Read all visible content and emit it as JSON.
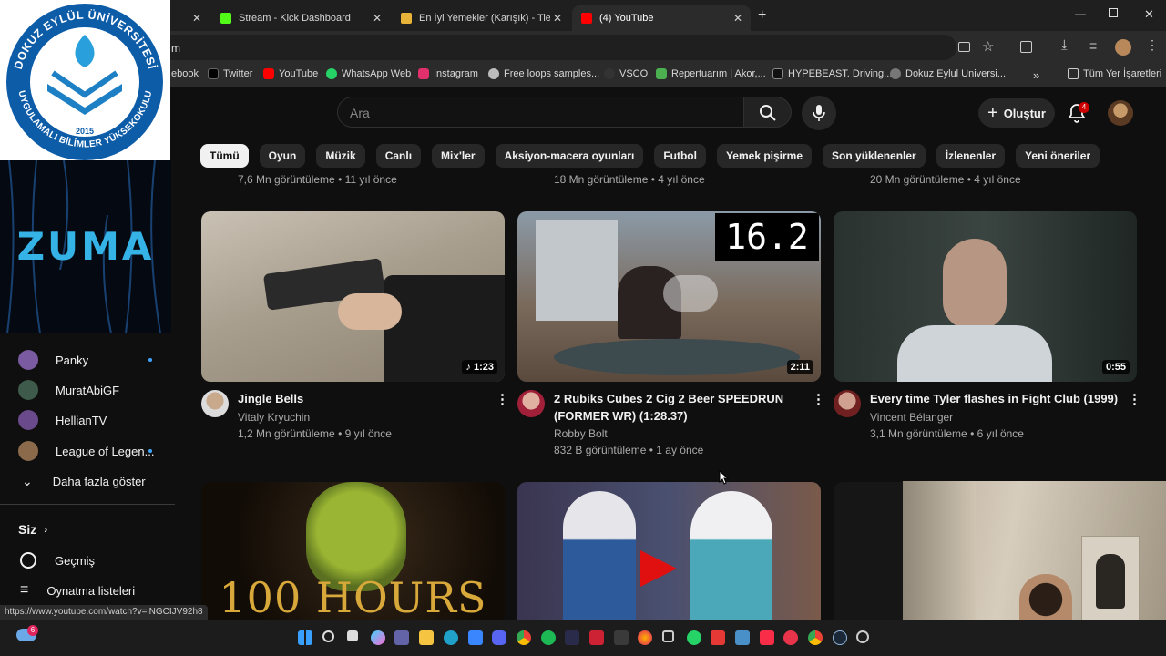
{
  "browser": {
    "tabs": [
      {
        "label": "Mic",
        "color": "#5fd26a",
        "active": false
      },
      {
        "label": "Stream - Kick Dashboard",
        "color": "#53fc18",
        "active": false
      },
      {
        "label": "En İyi Yemekler (Karışık) - Tier L",
        "color": "#e8b339",
        "active": false
      },
      {
        "label": "(4) YouTube",
        "color": "#ff0000",
        "active": true
      }
    ],
    "address_tail": "m",
    "bookmarks": [
      {
        "label": "ebook",
        "color": "#1877f2"
      },
      {
        "label": "Twitter",
        "color": "#000000"
      },
      {
        "label": "YouTube",
        "color": "#ff0000"
      },
      {
        "label": "WhatsApp Web",
        "color": "#25d366"
      },
      {
        "label": "Instagram",
        "color": "#e1306c"
      },
      {
        "label": "Free loops samples...",
        "color": "#bbbbbb"
      },
      {
        "label": "VSCO",
        "color": "#333333"
      },
      {
        "label": "Repertuarım | Akor,...",
        "color": "#4caf50"
      },
      {
        "label": "HYPEBEAST. Driving...",
        "color": "#111111"
      },
      {
        "label": "Dokuz Eylul Universi...",
        "color": "#777777"
      }
    ],
    "bookmarks_overflow": "»",
    "all_bookmarks": "Tüm Yer İşaretleri",
    "status_url": "https://www.youtube.com/watch?v=iNGCIJV92h8"
  },
  "header": {
    "search_placeholder": "Ara",
    "create_label": "Oluştur",
    "notif_count": "4"
  },
  "chips": [
    "Tümü",
    "Oyun",
    "Müzik",
    "Canlı",
    "Mix'ler",
    "Aksiyon-macera oyunları",
    "Futbol",
    "Yemek pişirme",
    "Son yüklenenler",
    "İzlenenler",
    "Yeni öneriler"
  ],
  "partial_meta": [
    "7,6 Mn görüntüleme • 11 yıl önce",
    "18 Mn görüntüleme • 4 yıl önce",
    "20 Mn görüntüleme • 4 yıl önce"
  ],
  "videos": [
    {
      "title": "Jingle Bells",
      "channel": "Vitaly Kryuchin",
      "meta": "1,2 Mn görüntüleme • 9 yıl önce",
      "duration": "♪ 1:23"
    },
    {
      "title": "2 Rubiks Cubes 2 Cig 2 Beer SPEEDRUN (FORMER WR) (1:28.37)",
      "channel": "Robby Bolt",
      "meta": "832 B görüntüleme • 1 ay önce",
      "duration": "2:11",
      "overlay": "16.2"
    },
    {
      "title": "Every time Tyler flashes in Fight Club (1999)",
      "channel": "Vincent Bélanger",
      "meta": "3,1 Mn görüntüleme • 6 yıl önce",
      "duration": "0:55"
    }
  ],
  "row2_thumb_text": "100 HOURS",
  "sidebar": {
    "subs": [
      {
        "name": "Panky",
        "dot": true,
        "color": "#7a5aa0"
      },
      {
        "name": "MuratAbiGF",
        "dot": false,
        "color": "#3d5a4a"
      },
      {
        "name": "HellianTV",
        "dot": false,
        "color": "#6a4a8a"
      },
      {
        "name": "League of Legen...",
        "dot": true,
        "color": "#8a6a4a"
      }
    ],
    "more": "Daha fazla göster",
    "you": "Siz",
    "history": "Geçmiş",
    "playlists": "Oynatma listeleri"
  },
  "overlay_logo": {
    "top": "DOKUZ EYLÜL ÜNİVERSİTESİ",
    "bottom": "UYGULAMALI BİLİMLER YÜKSEKOKULU",
    "year": "2015"
  },
  "overlay_game": "ZUMA",
  "taskbar": {
    "weather_badge": "6"
  }
}
